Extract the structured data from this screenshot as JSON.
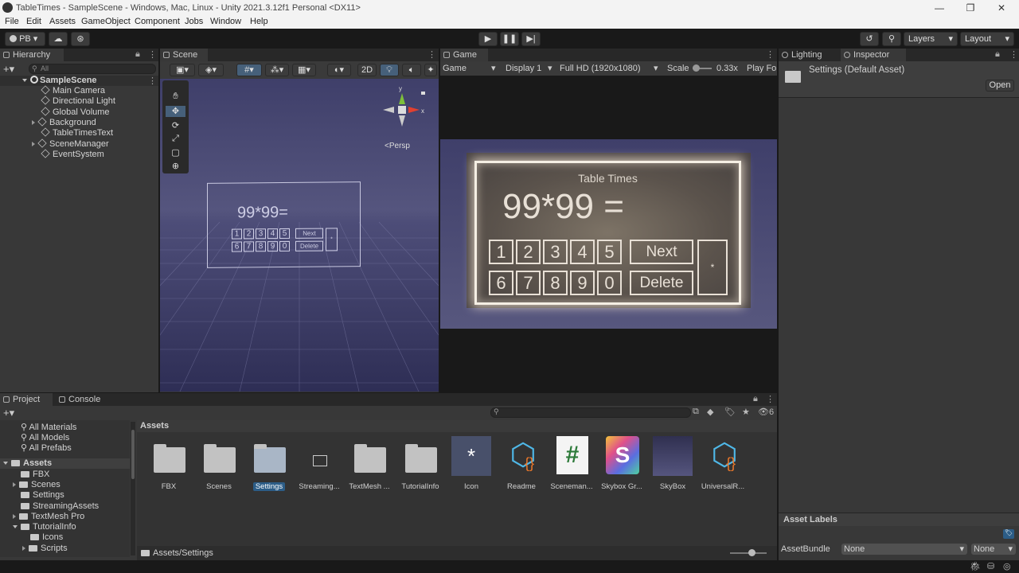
{
  "window": {
    "title": "TableTimes - SampleScene - Windows, Mac, Linux - Unity 2021.3.12f1 Personal <DX11>",
    "minimize": "—",
    "restore": "❐",
    "close": "✕"
  },
  "menu": [
    "File",
    "Edit",
    "Assets",
    "GameObject",
    "Component",
    "Jobs",
    "Window",
    "Help"
  ],
  "toolbar": {
    "account": "PB",
    "layers": "Layers",
    "layout": "Layout"
  },
  "hierarchy": {
    "tab": "Hierarchy",
    "search_placeholder": "All",
    "scene": "SampleScene",
    "items": [
      "Main Camera",
      "Directional Light",
      "Global Volume",
      "Background",
      "TableTimesText",
      "SceneManager",
      "EventSystem"
    ]
  },
  "scene": {
    "tab": "Scene",
    "mode2d": "2D",
    "persp": "<Persp",
    "axis_y": "y",
    "axis_x": "x",
    "equation": "99*99=",
    "next": "Next",
    "delete": "Delete",
    "star": "*"
  },
  "game": {
    "tab": "Game",
    "view": "Game",
    "display": "Display 1",
    "resolution": "Full HD (1920x1080)",
    "scale_label": "Scale",
    "scale_value": "0.33x",
    "play_focused": "Play Fo",
    "title": "Table Times",
    "equation": "99*99 =",
    "row1": [
      "1",
      "2",
      "3",
      "4",
      "5"
    ],
    "row2": [
      "6",
      "7",
      "8",
      "9",
      "0"
    ],
    "next": "Next",
    "delete": "Delete",
    "star": "*"
  },
  "inspector": {
    "tab_lighting": "Lighting",
    "tab_inspector": "Inspector",
    "title": "Settings (Default Asset)",
    "open": "Open",
    "asset_labels": "Asset Labels",
    "assetbundle_label": "AssetBundle",
    "assetbundle_value": "None",
    "variant_value": "None"
  },
  "project": {
    "tab_project": "Project",
    "tab_console": "Console",
    "favorites": [
      "All Materials",
      "All Models",
      "All Prefabs"
    ],
    "assets_root": "Assets",
    "tree": [
      "FBX",
      "Scenes",
      "Settings",
      "StreamingAssets",
      "TextMesh Pro",
      "TutorialInfo",
      "Icons",
      "Scripts"
    ],
    "breadcrumb": "Assets",
    "path": "Assets/Settings",
    "hidden_count": "6",
    "assets": [
      {
        "name": "FBX",
        "icon": "folder-icon"
      },
      {
        "name": "Scenes",
        "icon": "folder-icon"
      },
      {
        "name": "Settings",
        "icon": "folder-icon"
      },
      {
        "name": "Streaming...",
        "icon": "folder-empty-icon"
      },
      {
        "name": "TextMesh ...",
        "icon": "folder-icon"
      },
      {
        "name": "TutorialInfo",
        "icon": "folder-icon"
      },
      {
        "name": "Icon",
        "icon": "texture-icon"
      },
      {
        "name": "Readme",
        "icon": "scriptable-object-icon"
      },
      {
        "name": "Sceneman...",
        "icon": "csharp-script-icon"
      },
      {
        "name": "Skybox Gr...",
        "icon": "shader-icon"
      },
      {
        "name": "SkyBox",
        "icon": "material-icon"
      },
      {
        "name": "UniversalR...",
        "icon": "scriptable-object-icon"
      }
    ]
  },
  "colors": {
    "accent": "#2c5d87",
    "selection": "#2c5d87",
    "panel": "#383838",
    "game_frame": "#f5efe4"
  }
}
